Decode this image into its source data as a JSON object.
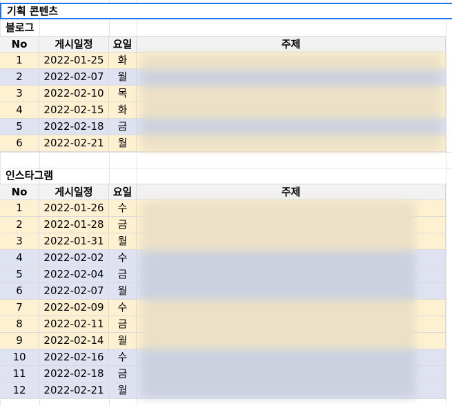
{
  "sheet_title": "기획 콘텐츠",
  "blog": {
    "label": "블로그",
    "headers": {
      "no": "No",
      "date": "게시일정",
      "day": "요일",
      "topic": "주제"
    },
    "rows": [
      {
        "no": "1",
        "date": "2022-01-25",
        "day": "화",
        "color": "yellow"
      },
      {
        "no": "2",
        "date": "2022-02-07",
        "day": "월",
        "color": "blue"
      },
      {
        "no": "3",
        "date": "2022-02-10",
        "day": "목",
        "color": "yellow"
      },
      {
        "no": "4",
        "date": "2022-02-15",
        "day": "화",
        "color": "yellow"
      },
      {
        "no": "5",
        "date": "2022-02-18",
        "day": "금",
        "color": "blue"
      },
      {
        "no": "6",
        "date": "2022-02-21",
        "day": "월",
        "color": "yellow"
      }
    ]
  },
  "instagram": {
    "label": "인스타그램",
    "headers": {
      "no": "No",
      "date": "게시일정",
      "day": "요일",
      "topic": "주제"
    },
    "rows": [
      {
        "no": "1",
        "date": "2022-01-26",
        "day": "수",
        "color": "yellow"
      },
      {
        "no": "2",
        "date": "2022-01-28",
        "day": "금",
        "color": "yellow"
      },
      {
        "no": "3",
        "date": "2022-01-31",
        "day": "월",
        "color": "yellow"
      },
      {
        "no": "4",
        "date": "2022-02-02",
        "day": "수",
        "color": "blue"
      },
      {
        "no": "5",
        "date": "2022-02-04",
        "day": "금",
        "color": "blue"
      },
      {
        "no": "6",
        "date": "2022-02-07",
        "day": "월",
        "color": "blue"
      },
      {
        "no": "7",
        "date": "2022-02-09",
        "day": "수",
        "color": "yellow"
      },
      {
        "no": "8",
        "date": "2022-02-11",
        "day": "금",
        "color": "yellow"
      },
      {
        "no": "9",
        "date": "2022-02-14",
        "day": "월",
        "color": "yellow"
      },
      {
        "no": "10",
        "date": "2022-02-16",
        "day": "수",
        "color": "blue"
      },
      {
        "no": "11",
        "date": "2022-02-18",
        "day": "금",
        "color": "blue"
      },
      {
        "no": "12",
        "date": "2022-02-21",
        "day": "월",
        "color": "blue"
      }
    ]
  },
  "colors": {
    "yellow": "#fdf1d1",
    "blue": "#dfe3f1",
    "header": "#f2f2f2",
    "selection": "#1a73e8"
  }
}
